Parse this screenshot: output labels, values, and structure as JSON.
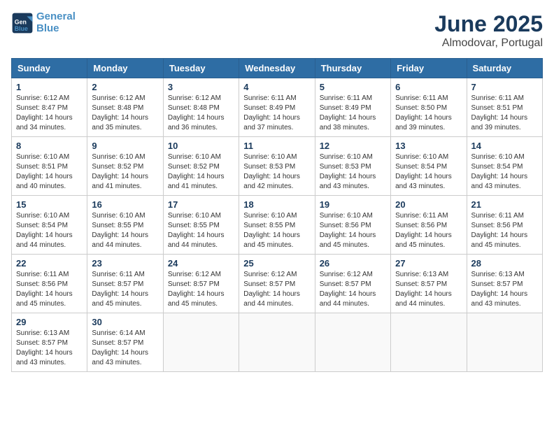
{
  "header": {
    "logo_line1": "General",
    "logo_line2": "Blue",
    "title": "June 2025",
    "subtitle": "Almodovar, Portugal"
  },
  "calendar": {
    "days_of_week": [
      "Sunday",
      "Monday",
      "Tuesday",
      "Wednesday",
      "Thursday",
      "Friday",
      "Saturday"
    ],
    "weeks": [
      [
        null,
        {
          "day": "2",
          "sunrise": "6:12 AM",
          "sunset": "8:48 PM",
          "daylight": "14 hours and 35 minutes."
        },
        {
          "day": "3",
          "sunrise": "6:12 AM",
          "sunset": "8:48 PM",
          "daylight": "14 hours and 36 minutes."
        },
        {
          "day": "4",
          "sunrise": "6:11 AM",
          "sunset": "8:49 PM",
          "daylight": "14 hours and 37 minutes."
        },
        {
          "day": "5",
          "sunrise": "6:11 AM",
          "sunset": "8:49 PM",
          "daylight": "14 hours and 38 minutes."
        },
        {
          "day": "6",
          "sunrise": "6:11 AM",
          "sunset": "8:50 PM",
          "daylight": "14 hours and 39 minutes."
        },
        {
          "day": "7",
          "sunrise": "6:11 AM",
          "sunset": "8:51 PM",
          "daylight": "14 hours and 39 minutes."
        }
      ],
      [
        {
          "day": "1",
          "sunrise": "6:12 AM",
          "sunset": "8:47 PM",
          "daylight": "14 hours and 34 minutes."
        },
        {
          "day": "8",
          "sunrise": "6:10 AM",
          "sunset": "8:51 PM",
          "daylight": "14 hours and 40 minutes."
        },
        {
          "day": "9",
          "sunrise": "6:10 AM",
          "sunset": "8:52 PM",
          "daylight": "14 hours and 41 minutes."
        },
        {
          "day": "10",
          "sunrise": "6:10 AM",
          "sunset": "8:52 PM",
          "daylight": "14 hours and 41 minutes."
        },
        {
          "day": "11",
          "sunrise": "6:10 AM",
          "sunset": "8:53 PM",
          "daylight": "14 hours and 42 minutes."
        },
        {
          "day": "12",
          "sunrise": "6:10 AM",
          "sunset": "8:53 PM",
          "daylight": "14 hours and 43 minutes."
        },
        {
          "day": "13",
          "sunrise": "6:10 AM",
          "sunset": "8:54 PM",
          "daylight": "14 hours and 43 minutes."
        },
        {
          "day": "14",
          "sunrise": "6:10 AM",
          "sunset": "8:54 PM",
          "daylight": "14 hours and 43 minutes."
        }
      ],
      [
        {
          "day": "15",
          "sunrise": "6:10 AM",
          "sunset": "8:54 PM",
          "daylight": "14 hours and 44 minutes."
        },
        {
          "day": "16",
          "sunrise": "6:10 AM",
          "sunset": "8:55 PM",
          "daylight": "14 hours and 44 minutes."
        },
        {
          "day": "17",
          "sunrise": "6:10 AM",
          "sunset": "8:55 PM",
          "daylight": "14 hours and 44 minutes."
        },
        {
          "day": "18",
          "sunrise": "6:10 AM",
          "sunset": "8:55 PM",
          "daylight": "14 hours and 45 minutes."
        },
        {
          "day": "19",
          "sunrise": "6:10 AM",
          "sunset": "8:56 PM",
          "daylight": "14 hours and 45 minutes."
        },
        {
          "day": "20",
          "sunrise": "6:11 AM",
          "sunset": "8:56 PM",
          "daylight": "14 hours and 45 minutes."
        },
        {
          "day": "21",
          "sunrise": "6:11 AM",
          "sunset": "8:56 PM",
          "daylight": "14 hours and 45 minutes."
        }
      ],
      [
        {
          "day": "22",
          "sunrise": "6:11 AM",
          "sunset": "8:56 PM",
          "daylight": "14 hours and 45 minutes."
        },
        {
          "day": "23",
          "sunrise": "6:11 AM",
          "sunset": "8:57 PM",
          "daylight": "14 hours and 45 minutes."
        },
        {
          "day": "24",
          "sunrise": "6:12 AM",
          "sunset": "8:57 PM",
          "daylight": "14 hours and 45 minutes."
        },
        {
          "day": "25",
          "sunrise": "6:12 AM",
          "sunset": "8:57 PM",
          "daylight": "14 hours and 44 minutes."
        },
        {
          "day": "26",
          "sunrise": "6:12 AM",
          "sunset": "8:57 PM",
          "daylight": "14 hours and 44 minutes."
        },
        {
          "day": "27",
          "sunrise": "6:13 AM",
          "sunset": "8:57 PM",
          "daylight": "14 hours and 44 minutes."
        },
        {
          "day": "28",
          "sunrise": "6:13 AM",
          "sunset": "8:57 PM",
          "daylight": "14 hours and 43 minutes."
        }
      ],
      [
        {
          "day": "29",
          "sunrise": "6:13 AM",
          "sunset": "8:57 PM",
          "daylight": "14 hours and 43 minutes."
        },
        {
          "day": "30",
          "sunrise": "6:14 AM",
          "sunset": "8:57 PM",
          "daylight": "14 hours and 43 minutes."
        },
        null,
        null,
        null,
        null,
        null
      ]
    ]
  }
}
